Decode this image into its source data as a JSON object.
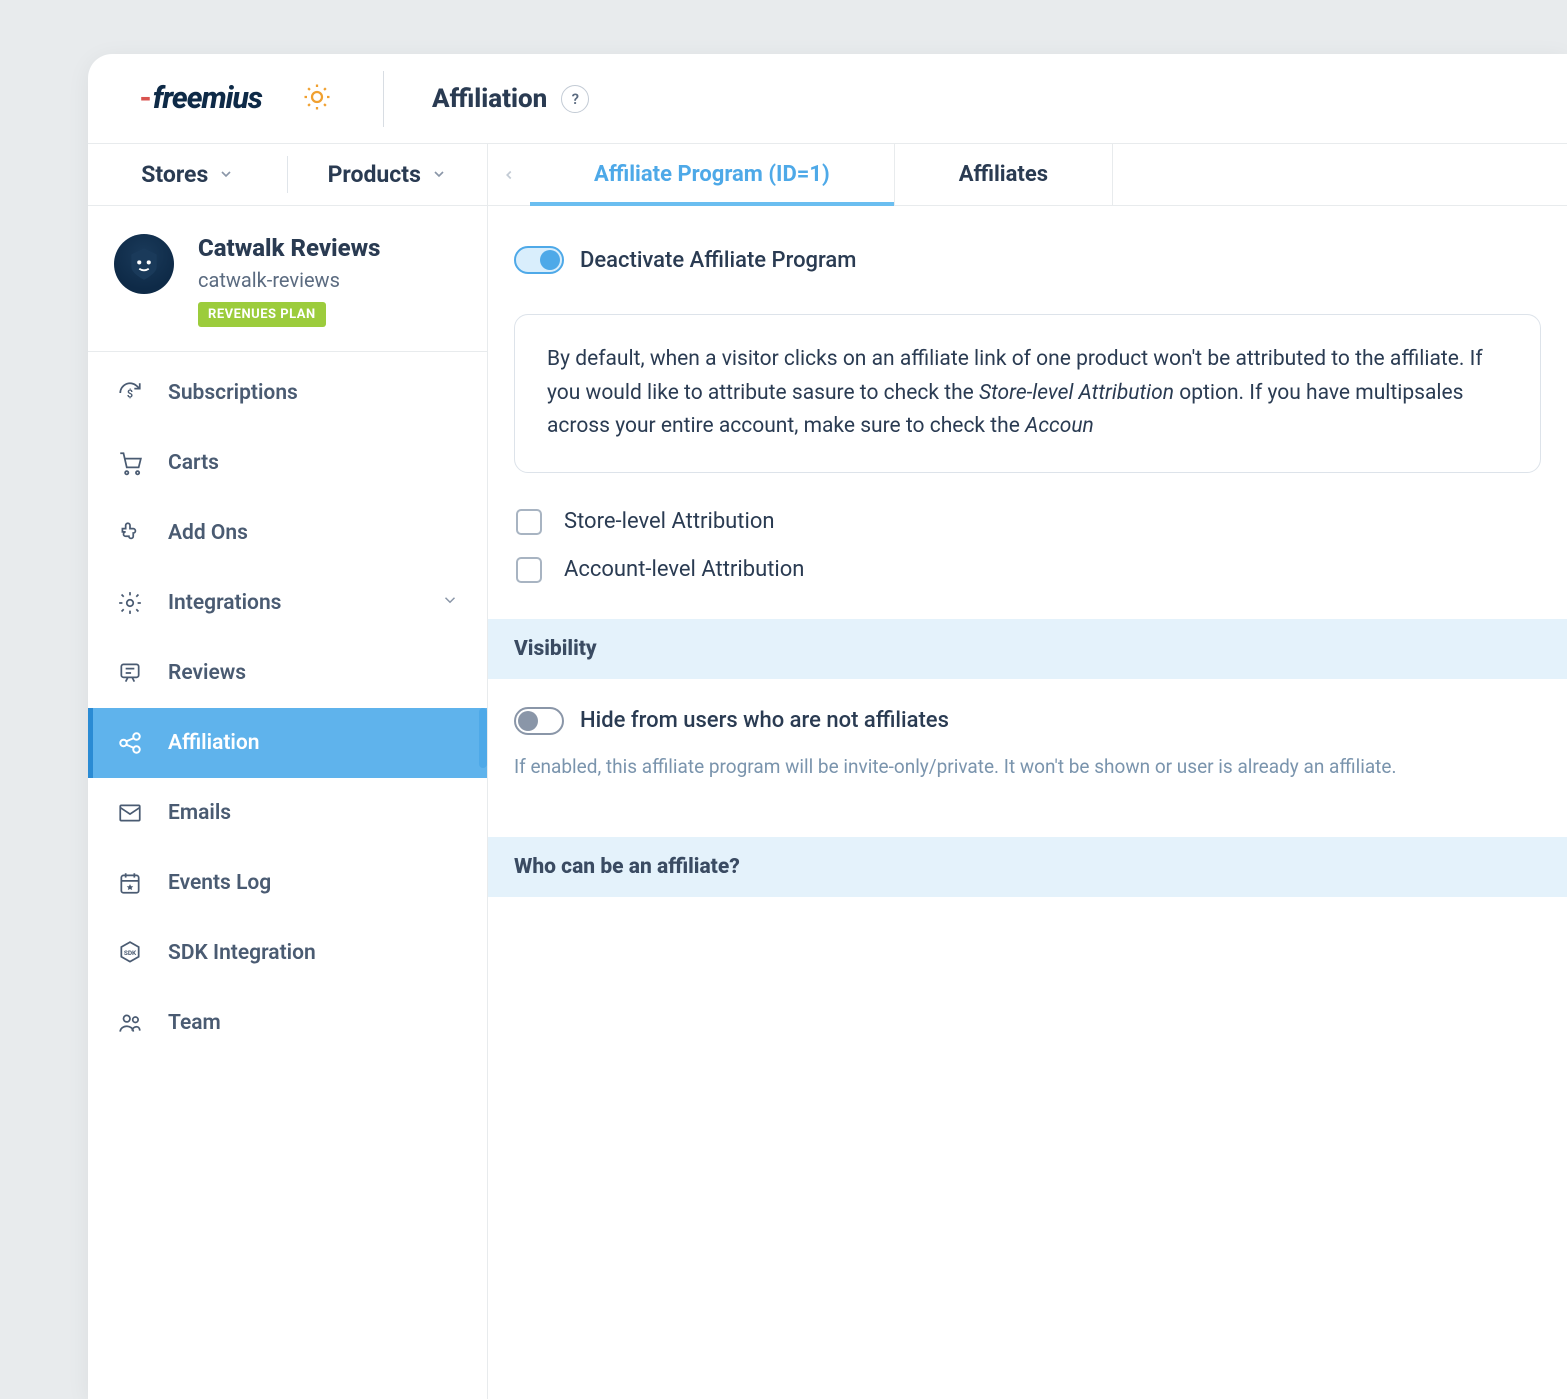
{
  "logo_text": "freemius",
  "page_title": "Affiliation",
  "nav": {
    "stores": "Stores",
    "products": "Products"
  },
  "product": {
    "name": "Catwalk Reviews",
    "slug": "catwalk-reviews",
    "plan_badge": "REVENUES PLAN"
  },
  "menu": [
    {
      "label": "Subscriptions",
      "icon": "refresh-dollar"
    },
    {
      "label": "Carts",
      "icon": "cart"
    },
    {
      "label": "Add Ons",
      "icon": "puzzle"
    },
    {
      "label": "Integrations",
      "icon": "gear",
      "expandable": true
    },
    {
      "label": "Reviews",
      "icon": "review"
    },
    {
      "label": "Affiliation",
      "icon": "share",
      "active": true
    },
    {
      "label": "Emails",
      "icon": "envelope"
    },
    {
      "label": "Events Log",
      "icon": "calendar"
    },
    {
      "label": "SDK Integration",
      "icon": "sdk"
    },
    {
      "label": "Team",
      "icon": "team"
    }
  ],
  "tabs": [
    {
      "label": "Affiliate Program (ID=1)",
      "active": true
    },
    {
      "label": "Affiliates",
      "active": false
    }
  ],
  "deactivate_toggle_label": "Deactivate Affiliate Program",
  "info_text_parts": {
    "p1": "By default, when a visitor clicks on an affiliate link of one product ",
    "p2": "won't be attributed to the affiliate. If you would like to attribute sa",
    "p3": "sure to check the ",
    "em1": "Store-level Attribution",
    "p4": " option. If you have multip",
    "p5": "sales across your entire account, make sure to check the ",
    "em2": "Accoun"
  },
  "checkboxes": {
    "store_level": "Store-level Attribution",
    "account_level": "Account-level Attribution"
  },
  "sections": {
    "visibility": {
      "title": "Visibility",
      "toggle_label": "Hide from users who are not affiliates",
      "hint": "If enabled, this affiliate program will be invite-only/private. It won't be shown or user is already an affiliate."
    },
    "who": {
      "title": "Who can be an affiliate?"
    }
  }
}
